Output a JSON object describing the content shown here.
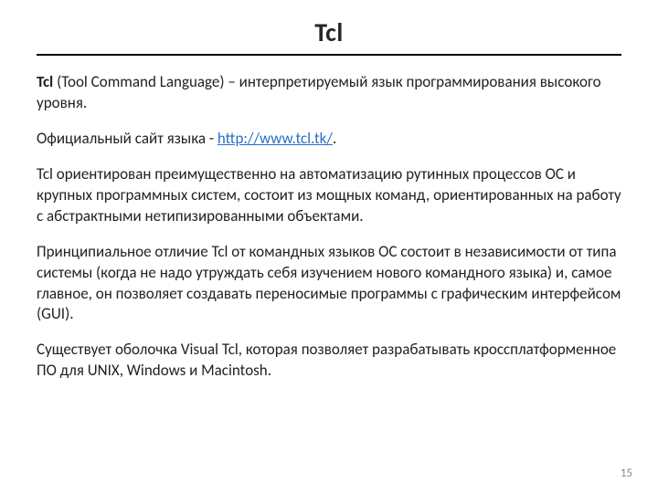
{
  "title": "Tcl",
  "para1": {
    "bold": "Tcl",
    "rest": " (Tool Command Language) –  интерпретируемый язык программирования высокого уровня."
  },
  "para2": {
    "before": "Официальный сайт языка - ",
    "link_text": "http://www.tcl.tk/",
    "link_href": "http://www.tcl.tk/",
    "after": "."
  },
  "para3": "Tcl ориентирован преимущественно на автоматизацию рутинных процессов ОС и крупных программных систем, состоит из мощных команд, ориентированных на работу с абстрактными нетипизированными объектами.",
  "para4": "Принципиальное отличие Tcl от командных языков ОС состоит в независимости от типа системы (когда не надо утруждать себя изучением нового командного языка) и, самое главное, он позволяет создавать переносимые программы с графическим интерфейсом (GUI).",
  "para5": "Существует оболочка Visual Tcl, которая позволяет разрабатывать кроссплатформенное ПО для UNIX, Windows и Macintosh.",
  "page_number": "15"
}
